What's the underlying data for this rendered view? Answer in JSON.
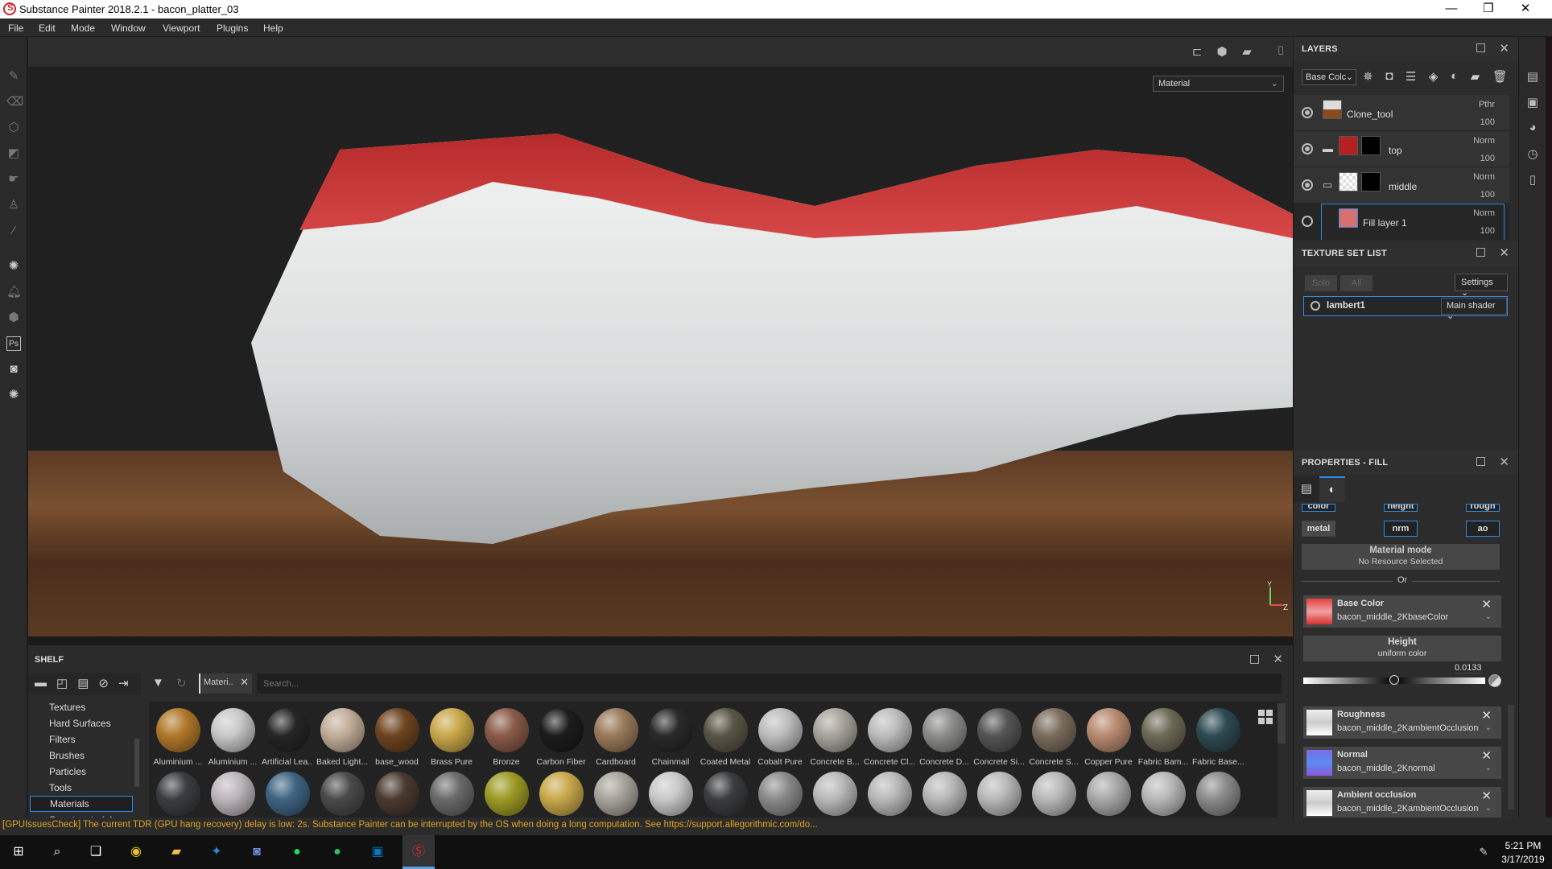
{
  "window": {
    "title": "Substance Painter 2018.2.1 - bacon_platter_03",
    "minimize": "—",
    "maximize": "❐",
    "close": "✕"
  },
  "menu": [
    "File",
    "Edit",
    "Mode",
    "Window",
    "Viewport",
    "Plugins",
    "Help"
  ],
  "viewport": {
    "display_mode": "Material",
    "axis": {
      "y": "Y",
      "z": "Z"
    }
  },
  "left_tools": [
    "paint-brush",
    "eraser",
    "projection",
    "polygon-fill",
    "smudge",
    "clone-stamp",
    "color-picker",
    "substance-share",
    "notification",
    "substance-source",
    "photoshop",
    "resource-updater",
    "substance-settings"
  ],
  "layers": {
    "title": "LAYERS",
    "channel": "Base Colc",
    "rows": [
      {
        "name": "Clone_tool",
        "blend": "Pthr",
        "opacity": "100",
        "visible": true,
        "type": "layer"
      },
      {
        "name": "top",
        "blend": "Norm",
        "opacity": "100",
        "visible": true,
        "type": "folder"
      },
      {
        "name": "middle",
        "blend": "Norm",
        "opacity": "100",
        "visible": true,
        "type": "folder-open"
      },
      {
        "name": "Fill layer 1",
        "blend": "Norm",
        "opacity": "100",
        "visible": false,
        "type": "fill",
        "selected": true
      }
    ]
  },
  "texture_set_list": {
    "title": "TEXTURE SET LIST",
    "solo": "Solo",
    "all": "All",
    "settings": "Settings",
    "set_name": "lambert1",
    "shader": "Main shader"
  },
  "properties": {
    "title": "PROPERTIES - FILL",
    "channels": {
      "color": "color",
      "height": "height",
      "rough": "rough",
      "metal": "metal",
      "nrm": "nrm",
      "ao": "ao"
    },
    "material_mode": {
      "title": "Material mode",
      "value": "No Resource Selected"
    },
    "or_label": "Or",
    "base_color": {
      "name": "Base Color",
      "value": "bacon_middle_2KbaseColor"
    },
    "height": {
      "name": "Height",
      "value": "uniform color",
      "number": "0.0133",
      "slider_fraction": 0.5
    },
    "roughness": {
      "name": "Roughness",
      "value": "bacon_middle_2KambientOcclusion"
    },
    "normal": {
      "name": "Normal",
      "value": "bacon_middle_2Knormal"
    },
    "ao": {
      "name": "Ambient occlusion",
      "value": "bacon_middle_2KambientOcclusion"
    }
  },
  "shelf": {
    "title": "SHELF",
    "filter_tag": "Materi..",
    "search_placeholder": "Search...",
    "categories": [
      "Textures",
      "Hard Surfaces",
      "Filters",
      "Brushes",
      "Particles",
      "Tools",
      "Materials",
      "Smart materials"
    ],
    "selected_category": "Materials",
    "materials_row1": [
      {
        "name": "Aluminium ...",
        "color": "#b0782a"
      },
      {
        "name": "Aluminium ...",
        "color": "#c8c8c8"
      },
      {
        "name": "Artificial Lea...",
        "color": "#262626"
      },
      {
        "name": "Baked Light...",
        "color": "#c2ad98"
      },
      {
        "name": "base_wood",
        "color": "#6e4421"
      },
      {
        "name": "Brass Pure",
        "color": "#c9a84a"
      },
      {
        "name": "Bronze",
        "color": "#8a5a48"
      },
      {
        "name": "Carbon Fiber",
        "color": "#1c1c1c"
      },
      {
        "name": "Cardboard",
        "color": "#9a7a5a"
      },
      {
        "name": "Chainmail",
        "color": "#2a2a2a"
      },
      {
        "name": "Coated Metal",
        "color": "#5a5646"
      },
      {
        "name": "Cobalt Pure",
        "color": "#bdbdbd"
      },
      {
        "name": "Concrete B...",
        "color": "#a8a49c"
      },
      {
        "name": "Concrete Cl...",
        "color": "#bcbcbc"
      },
      {
        "name": "Concrete D...",
        "color": "#8c8c8a"
      },
      {
        "name": "Concrete Si...",
        "color": "#555555"
      },
      {
        "name": "Concrete S...",
        "color": "#7a6c5c"
      },
      {
        "name": "Copper Pure",
        "color": "#b88a70"
      },
      {
        "name": "Fabric Bam...",
        "color": "#6e6a58"
      },
      {
        "name": "Fabric Base...",
        "color": "#2e4a52"
      }
    ],
    "materials_row2_colors": [
      "#3a3e42",
      "#bdb6bc",
      "#3e6482",
      "#4a4a4a",
      "#4a3a30",
      "#6a6a6a",
      "#9c9a24",
      "#c9a84a",
      "#a8a49c",
      "#c8c8c8",
      "#3a3c3e",
      "#8a8a8a",
      "#b8b8b8",
      "#b8b8b8",
      "#b8b8b8",
      "#b8b8b8",
      "#b8b8b8",
      "#a8a8a8",
      "#b8b8b8",
      "#8a8a8a"
    ]
  },
  "status": "[GPUIssuesCheck] The current TDR (GPU hang recovery) delay is low: 2s. Substance Painter can be interrupted by the OS when doing a long computation. See https://support.allegorithmic.com/do...",
  "taskbar": {
    "apps": [
      "windows-start",
      "search",
      "task-view",
      "chrome",
      "file-explorer",
      "kodi",
      "discord",
      "spotify",
      "evernote",
      "trello",
      "substance-painter"
    ],
    "time": "5:21 PM",
    "date": "3/17/2019"
  }
}
